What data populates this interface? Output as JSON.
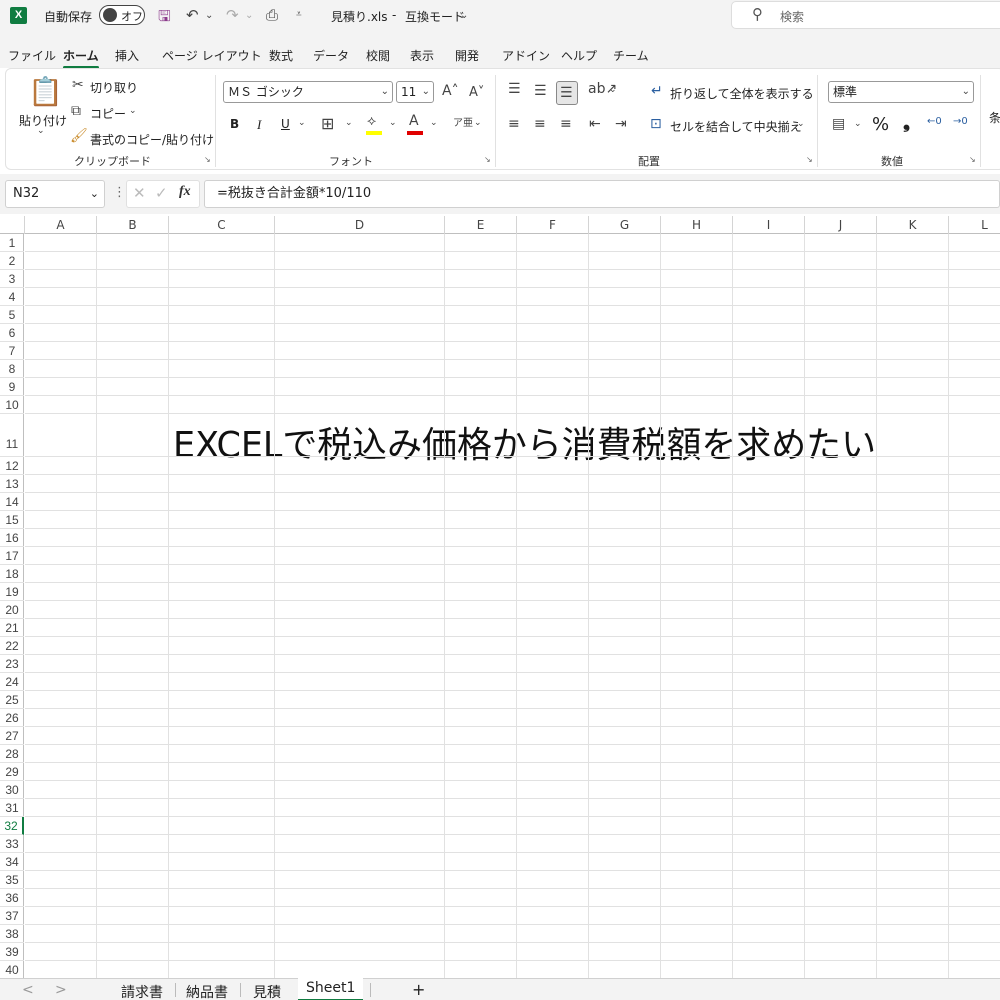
{
  "titlebar": {
    "autosave_label": "自動保存",
    "autosave_state": "オフ",
    "filename": "見積り.xls",
    "separator": "-",
    "mode": "互換モード",
    "search_placeholder": "検索"
  },
  "menu": {
    "tabs": [
      "ファイル",
      "ホーム",
      "挿入",
      "ページ レイアウト",
      "数式",
      "データ",
      "校閲",
      "表示",
      "開発",
      "アドイン",
      "ヘルプ",
      "チーム"
    ]
  },
  "ribbon": {
    "clipboard": {
      "paste": "貼り付け",
      "cut": "切り取り",
      "copy": "コピー",
      "format_painter": "書式のコピー/貼り付け",
      "label": "クリップボード"
    },
    "font": {
      "font_name": "ＭＳ ゴシック",
      "font_size": "11",
      "bold": "B",
      "italic": "I",
      "underline": "U",
      "label": "フォント"
    },
    "alignment": {
      "wrap": "折り返して全体を表示する",
      "merge": "セルを結合して中央揃え",
      "label": "配置"
    },
    "number": {
      "format": "標準",
      "percent": "%",
      "comma": "❟",
      "label": "数値"
    },
    "overflow": "条"
  },
  "formula_bar": {
    "name_box": "N32",
    "fx": "fx",
    "formula": "=税抜き合計金額*10/110"
  },
  "sheet": {
    "columns": [
      "A",
      "B",
      "C",
      "D",
      "E",
      "F",
      "G",
      "H",
      "I",
      "J",
      "K",
      "L"
    ],
    "rows": [
      "1",
      "2",
      "3",
      "4",
      "5",
      "6",
      "7",
      "8",
      "9",
      "10",
      "11",
      "12",
      "13",
      "14",
      "15",
      "16",
      "17",
      "18",
      "19",
      "20",
      "21",
      "22",
      "23",
      "24",
      "25",
      "26",
      "27",
      "28",
      "29",
      "30",
      "31",
      "32",
      "33",
      "34",
      "35",
      "36",
      "37",
      "38",
      "39",
      "40"
    ],
    "selected_row": "32",
    "cell_c11": "EXCELで税込み価格から消費税額を求めたい"
  },
  "sheet_tabs": {
    "tabs": [
      "請求書",
      "納品書",
      "見積",
      "Sheet1"
    ],
    "active": "Sheet1",
    "add": "+",
    "prev": "<",
    "next": ">"
  }
}
